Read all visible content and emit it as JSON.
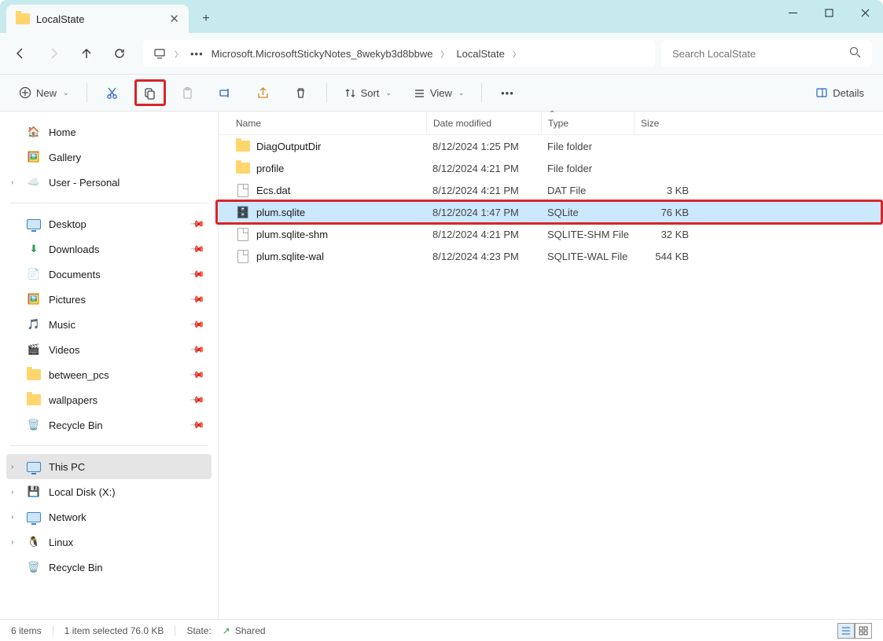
{
  "window": {
    "tab_title": "LocalState",
    "minimize": "—",
    "maximize": "□",
    "close": "✕"
  },
  "nav": {
    "back": "←",
    "forward": "→",
    "up": "↑",
    "refresh": "⟳"
  },
  "address": {
    "crumb1": "Microsoft.MicrosoftStickyNotes_8wekyb3d8bbwe",
    "crumb2": "LocalState"
  },
  "search": {
    "placeholder": "Search LocalState"
  },
  "toolbar": {
    "new": "New",
    "sort": "Sort",
    "view": "View",
    "details": "Details"
  },
  "columns": {
    "name": "Name",
    "date": "Date modified",
    "type": "Type",
    "size": "Size"
  },
  "files": [
    {
      "name": "DiagOutputDir",
      "date": "8/12/2024 1:25 PM",
      "type": "File folder",
      "size": "",
      "icon": "folder"
    },
    {
      "name": "profile",
      "date": "8/12/2024 4:21 PM",
      "type": "File folder",
      "size": "",
      "icon": "folder"
    },
    {
      "name": "Ecs.dat",
      "date": "8/12/2024 4:21 PM",
      "type": "DAT File",
      "size": "3 KB",
      "icon": "file"
    },
    {
      "name": "plum.sqlite",
      "date": "8/12/2024 1:47 PM",
      "type": "SQLite",
      "size": "76 KB",
      "icon": "sqlite",
      "selected": true,
      "highlighted": true
    },
    {
      "name": "plum.sqlite-shm",
      "date": "8/12/2024 4:21 PM",
      "type": "SQLITE-SHM File",
      "size": "32 KB",
      "icon": "file"
    },
    {
      "name": "plum.sqlite-wal",
      "date": "8/12/2024 4:23 PM",
      "type": "SQLITE-WAL File",
      "size": "544 KB",
      "icon": "file"
    }
  ],
  "sidebar": {
    "home": "Home",
    "gallery": "Gallery",
    "user": "User - Personal",
    "desktop": "Desktop",
    "downloads": "Downloads",
    "documents": "Documents",
    "pictures": "Pictures",
    "music": "Music",
    "videos": "Videos",
    "between_pcs": "between_pcs",
    "wallpapers": "wallpapers",
    "recyclebin": "Recycle Bin",
    "thispc": "This PC",
    "localdisk": "Local Disk (X:)",
    "network": "Network",
    "linux": "Linux",
    "recyclebin2": "Recycle Bin"
  },
  "status": {
    "count": "6 items",
    "selected": "1 item selected  76.0 KB",
    "state_label": "State:",
    "state_value": "Shared"
  }
}
